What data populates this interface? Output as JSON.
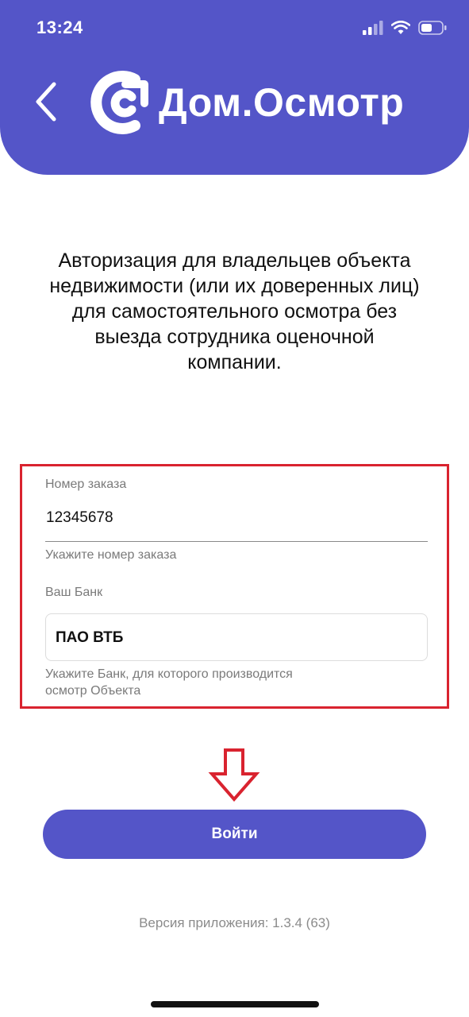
{
  "status_bar": {
    "time": "13:24"
  },
  "header": {
    "logo_text": "Дом.Осмотр",
    "background_color": "#5455c8"
  },
  "intro": {
    "text": "Авторизация для владельцев объекта недвижимости (или их доверенных лиц) для самостоятельного осмотра без выезда сотрудника оценочной компании."
  },
  "form": {
    "order_label": "Номер заказа",
    "order_value": "12345678",
    "order_hint": "Укажите номер заказа",
    "bank_label": "Ваш Банк",
    "bank_value": "ПАО ВТБ",
    "bank_hint_line1": "Укажите Банк, для которого производится",
    "bank_hint_line2": "осмотр Объекта",
    "highlight_color": "#d9232f"
  },
  "login_button": {
    "label": "Войти"
  },
  "footer": {
    "version": "Версия приложения: 1.3.4 (63)"
  },
  "icons": {
    "back": "chevron-left-icon",
    "logo": "logo-icon",
    "signal": "signal-icon",
    "wifi": "wifi-icon",
    "battery": "battery-icon",
    "arrow": "arrow-down-icon"
  }
}
